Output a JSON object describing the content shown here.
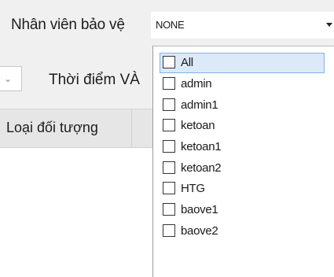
{
  "filter": {
    "label": "Nhân viên bảo vệ",
    "selected_value": "NONE"
  },
  "time": {
    "label": "Thời điểm VÀ"
  },
  "table_header": {
    "first_column": "Loại đối tượng"
  },
  "dropdown": {
    "items": [
      {
        "label": "All",
        "checked": false,
        "highlighted": true
      },
      {
        "label": "admin",
        "checked": false
      },
      {
        "label": "admin1",
        "checked": false
      },
      {
        "label": "ketoan",
        "checked": false
      },
      {
        "label": "ketoan1",
        "checked": false
      },
      {
        "label": "ketoan2",
        "checked": false
      },
      {
        "label": "HTG",
        "checked": false
      },
      {
        "label": "baove1",
        "checked": false
      },
      {
        "label": "baove2",
        "checked": false
      }
    ]
  },
  "icons": {
    "select_caret": "caret-down-icon",
    "stub_chevron": "chevron-down-icon"
  }
}
